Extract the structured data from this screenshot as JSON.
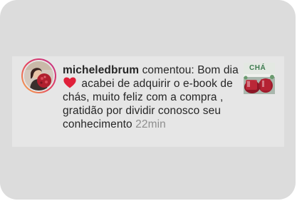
{
  "notification": {
    "username": "micheledbrum",
    "action": " comentou: Bom dia",
    "message_rest": " acabei de adquirir o e-book de chás,  muito feliz com a compra , gratidão por dividir conosco seu conhecimento",
    "time": "22min",
    "emoji": "red-heart",
    "thumbnail": {
      "title": "CHÁ"
    }
  },
  "colors": {
    "card_bg": "#dcdcdc",
    "notification_bg": "#e6e6e6",
    "text": "#262626",
    "muted_text": "#8e8e8e",
    "heart": "#e0203a"
  }
}
